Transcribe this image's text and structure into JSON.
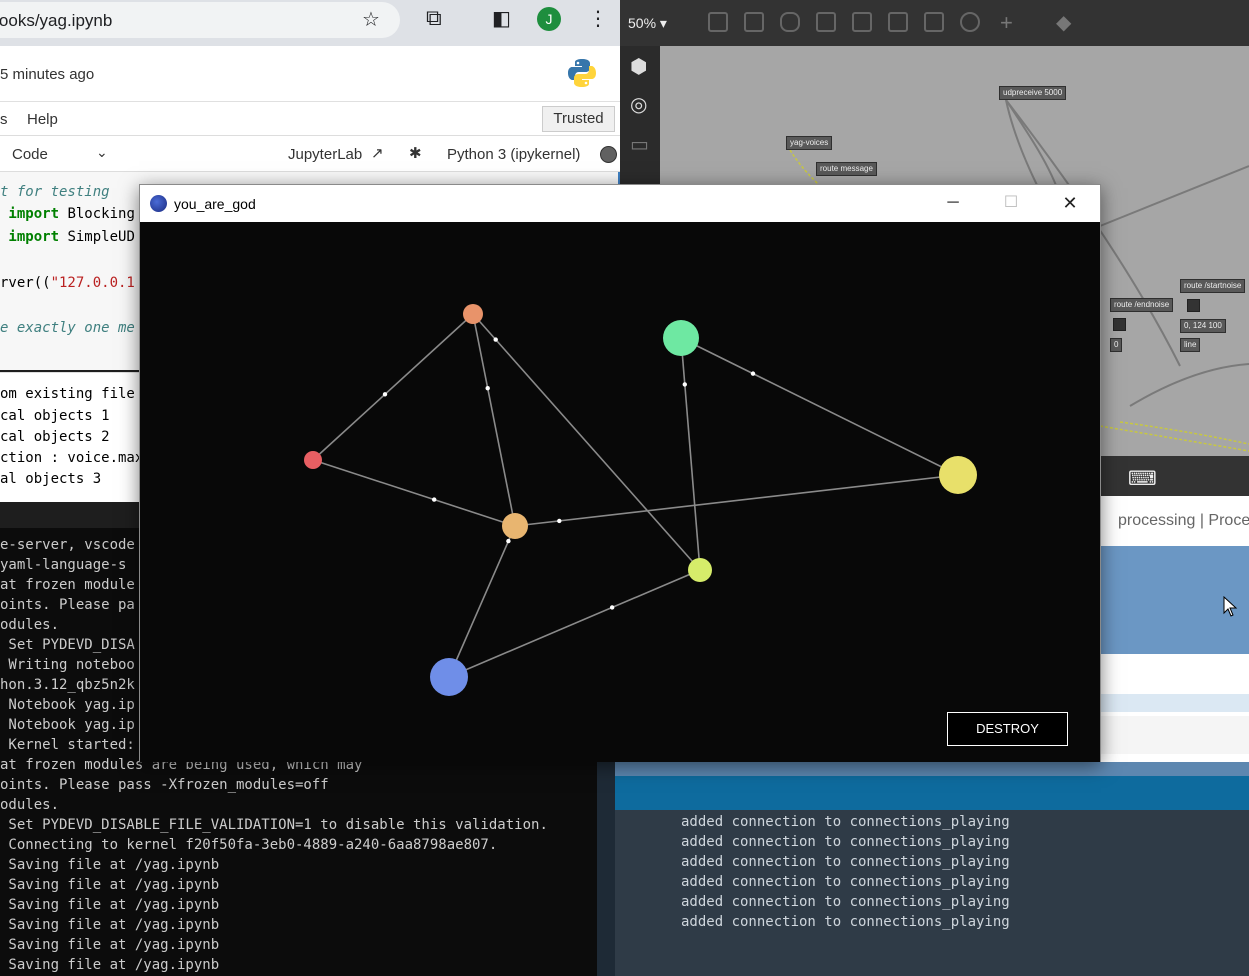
{
  "browser": {
    "url": "ebooks/yag.ipynb"
  },
  "jupyter": {
    "last_saved": "5 minutes ago",
    "menu": [
      "s",
      "Help"
    ],
    "trusted": "Trusted",
    "cell_type": "Code",
    "jupyterlab_link": "JupyterLab",
    "kernel": "Python 3 (ipykernel)",
    "code_lines": [
      {
        "cls": "comment",
        "text": "t for testing"
      },
      {
        "cls": "import",
        "kw": " import",
        "rest": " Blocking"
      },
      {
        "cls": "import",
        "kw": " import",
        "rest": " SimpleUD"
      },
      {
        "cls": "plain",
        "text": ""
      },
      {
        "cls": "call",
        "pre": "rver((",
        "str": "\"127.0.0.1"
      },
      {
        "cls": "plain",
        "text": ""
      },
      {
        "cls": "comment",
        "text": "e exactly one me"
      }
    ],
    "output_lines": [
      "om existing file",
      "cal objects 1",
      "cal objects 2",
      "ction : voice.max",
      "al objects 3"
    ]
  },
  "terminal": {
    "lines": [
      "e-server, vscode",
      "yaml-language-s",
      "at frozen module",
      "oints. Please pa",
      "odules.",
      " Set PYDEVD_DISA",
      " Writing noteboo",
      "hon.3.12_qbz5n2k",
      " Notebook yag.ip",
      " Notebook yag.ip",
      " Kernel started:",
      "at frozen modules are being used, which may",
      "oints. Please pass -Xfrozen_modules=off",
      "odules.",
      " Set PYDEVD_DISABLE_FILE_VALIDATION=1 to disable this validation.",
      " Connecting to kernel f20f50fa-3eb0-4889-a240-6aa8798ae807.",
      " Saving file at /yag.ipynb",
      " Saving file at /yag.ipynb",
      " Saving file at /yag.ipynb",
      " Saving file at /yag.ipynb",
      " Saving file at /yag.ipynb",
      " Saving file at /yag.ipynb"
    ]
  },
  "max": {
    "zoom": "50%",
    "objects": {
      "udpreceive": "udpreceive 5000",
      "yag_voices": "yag-voices",
      "route_message": "route message",
      "route_startnoise": "route /startnoise",
      "route_endnoise": "route /endnoise",
      "msg_124": "0, 124 100",
      "line": "line",
      "zero": "0"
    }
  },
  "web": {
    "processing": "processing | Proce"
  },
  "vscode": {
    "output_lines": [
      "added connection to connections_playing",
      "added connection to connections_playing",
      "added connection to connections_playing",
      "added connection to connections_playing",
      "added connection to connections_playing",
      "added connection to connections_playing"
    ]
  },
  "app": {
    "title": "you_are_god",
    "destroy_label": "DESTROY",
    "nodes": [
      {
        "id": "n1",
        "color": "#e8936a",
        "size": 10
      },
      {
        "id": "n2",
        "color": "#6ee8a2",
        "size": 18
      },
      {
        "id": "n3",
        "color": "#e85f63",
        "size": 9
      },
      {
        "id": "n4",
        "color": "#e8b570",
        "size": 13
      },
      {
        "id": "n5",
        "color": "#e8e06a",
        "size": 19
      },
      {
        "id": "n6",
        "color": "#d6ec6a",
        "size": 12
      },
      {
        "id": "n7",
        "color": "#6f8ee8",
        "size": 19
      }
    ],
    "edges": [
      [
        "n1",
        "n3"
      ],
      [
        "n1",
        "n4"
      ],
      [
        "n1",
        "n6"
      ],
      [
        "n3",
        "n4"
      ],
      [
        "n4",
        "n5"
      ],
      [
        "n4",
        "n7"
      ],
      [
        "n7",
        "n6"
      ],
      [
        "n2",
        "n6"
      ],
      [
        "n2",
        "n5"
      ]
    ]
  }
}
